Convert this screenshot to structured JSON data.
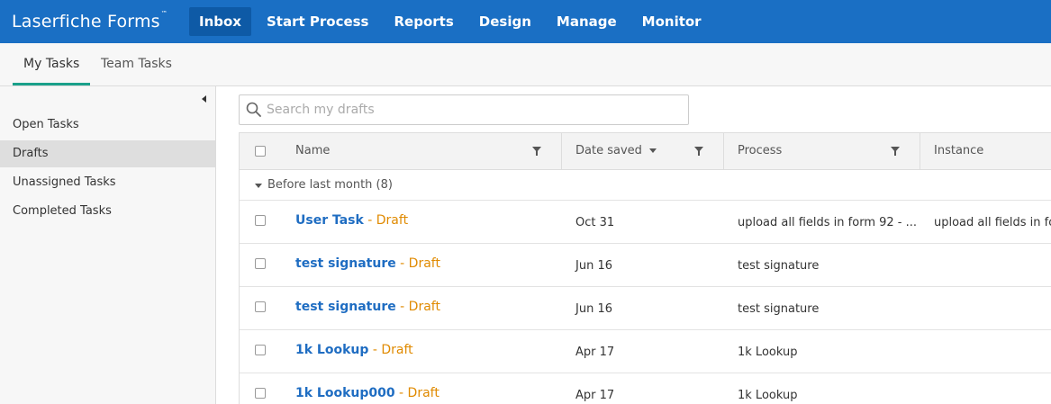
{
  "app": {
    "brand": "Laserfiche Forms",
    "trademark": "™"
  },
  "nav": [
    "Inbox",
    "Start Process",
    "Reports",
    "Design",
    "Manage",
    "Monitor"
  ],
  "subtabs": [
    "My Tasks",
    "Team Tasks"
  ],
  "sidebar": [
    "Open Tasks",
    "Drafts",
    "Unassigned Tasks",
    "Completed Tasks"
  ],
  "search": {
    "placeholder": "Search my drafts",
    "value": ""
  },
  "columns": [
    "Name",
    "Date saved",
    "Process",
    "Instance"
  ],
  "group": {
    "label": "Before last month (8)"
  },
  "draft_suffix": " - Draft",
  "rows": [
    {
      "name": "User Task",
      "date": "Oct 31",
      "process": "upload all fields in form 92 - ...",
      "instance": "upload all fields in for"
    },
    {
      "name": "test signature",
      "date": "Jun 16",
      "process": "test signature",
      "instance": ""
    },
    {
      "name": "test signature",
      "date": "Jun 16",
      "process": "test signature",
      "instance": ""
    },
    {
      "name": "1k Lookup",
      "date": "Apr 17",
      "process": "1k Lookup",
      "instance": ""
    },
    {
      "name": "1k Lookup000",
      "date": "Apr 17",
      "process": "1k Lookup",
      "instance": ""
    }
  ],
  "colors": {
    "topbar": "#1a6fc4",
    "active_nav": "#0e5aa6",
    "tab_underline": "#1aa08a",
    "link": "#1f6dc2",
    "draft": "#e08a00"
  }
}
